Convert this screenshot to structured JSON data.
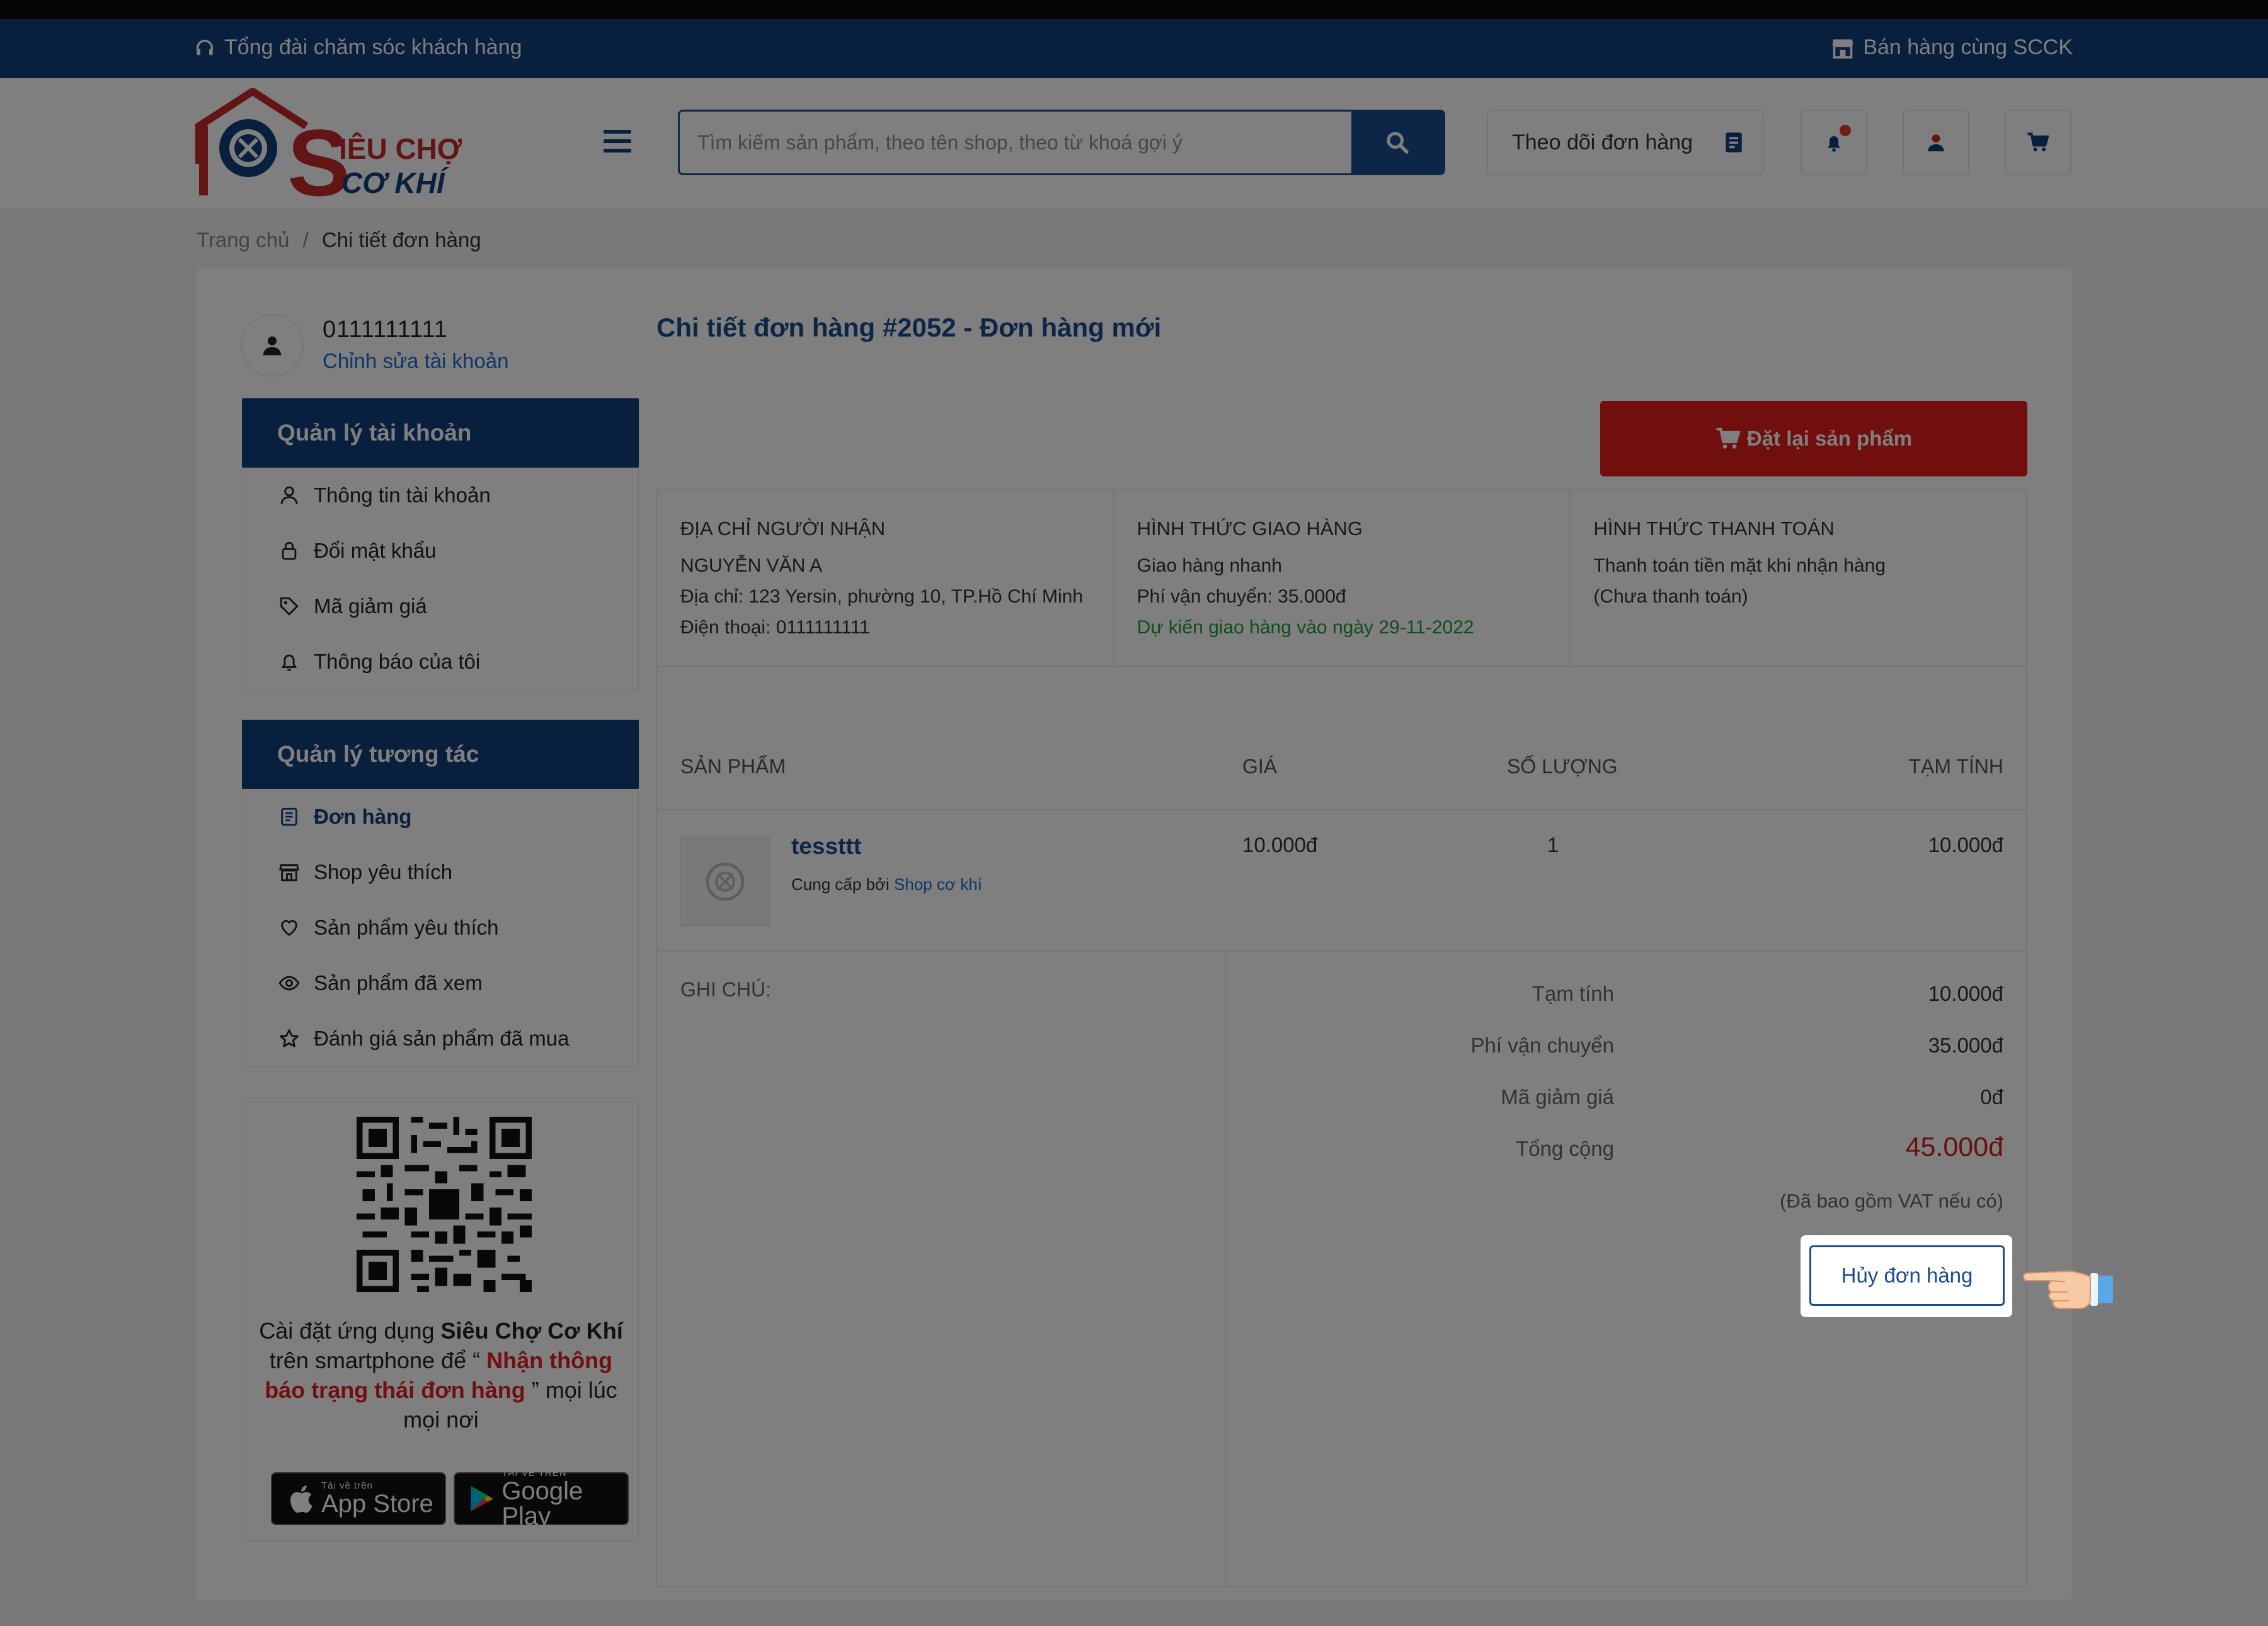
{
  "topbar": {
    "support_label": "Tổng đài chăm sóc khách hàng",
    "sell_label": "Bán hàng cùng SCCK"
  },
  "header": {
    "logo_line1": "IÊU CHỢ",
    "logo_line2": "CƠ KHÍ",
    "search_placeholder": "Tìm kiếm sản phẩm, theo tên shop, theo từ khoá gợi ý",
    "track_label": "Theo dõi đơn hàng"
  },
  "breadcrumb": {
    "home": "Trang chủ",
    "separator": "/",
    "current": "Chi tiết đơn hàng"
  },
  "account": {
    "phone": "0111111111",
    "edit_label": "Chỉnh sửa tài khoản"
  },
  "sidebar": {
    "section1": {
      "title": "Quản lý tài khoản",
      "items": [
        {
          "label": "Thông tin tài khoản",
          "icon": "user-icon"
        },
        {
          "label": "Đổi mật khẩu",
          "icon": "lock-icon"
        },
        {
          "label": "Mã giảm giá",
          "icon": "tag-icon"
        },
        {
          "label": "Thông báo của tôi",
          "icon": "bell-icon"
        }
      ]
    },
    "section2": {
      "title": "Quản lý tương tác",
      "items": [
        {
          "label": "Đơn hàng",
          "icon": "orders-icon",
          "active": true
        },
        {
          "label": "Shop yêu thích",
          "icon": "store-icon"
        },
        {
          "label": "Sản phẩm yêu thích",
          "icon": "heart-icon"
        },
        {
          "label": "Sản phẩm đã xem",
          "icon": "eye-icon"
        },
        {
          "label": "Đánh giá sản phẩm đã mua",
          "icon": "star-icon"
        }
      ]
    }
  },
  "app_promo": {
    "text1": "Cài đặt ứng dụng ",
    "app_name": "Siêu Chợ Cơ Khí",
    "text2": " trên smartphone để “ ",
    "highlight": "Nhận thông báo trạng thái đơn hàng",
    "text3": " ” mọi lúc mọi nơi",
    "appstore_small": "Tải về trên",
    "appstore_big": "App Store",
    "googleplay_small": "TẢI VỀ TRÊN",
    "googleplay_big": "Google Play"
  },
  "order": {
    "title": "Chi tiết đơn hàng #2052 - Đơn hàng mới",
    "reorder_label": "Đặt lại sản phẩm",
    "recipient": {
      "heading": "ĐỊA CHỈ NGƯỜI NHẬN",
      "name": "NGUYỄN VĂN A",
      "address": "Địa chỉ: 123 Yersin, phường 10, TP.Hồ Chí Minh",
      "phone": "Điện thoại: 0111111111"
    },
    "shipping": {
      "heading": "HÌNH THỨC GIAO HÀNG",
      "method": "Giao hàng nhanh",
      "fee": "Phí vận chuyển: 35.000đ",
      "eta": "Dự kiến giao hàng vào ngày 29-11-2022"
    },
    "payment": {
      "heading": "HÌNH THỨC THANH TOÁN",
      "method": "Thanh toán tiền mặt khi nhận hàng",
      "status": "(Chưa thanh toán)"
    },
    "table": {
      "headers": [
        "SẢN PHẨM",
        "GIÁ",
        "SỐ LƯỢNG",
        "TẠM TÍNH"
      ],
      "items": [
        {
          "name": "tessttt",
          "supplier_prefix": "Cung cấp bởi",
          "supplier": "Shop cơ khí",
          "price": "10.000đ",
          "qty": "1",
          "subtotal": "10.000đ"
        }
      ]
    },
    "note_label": "GHI CHÚ:",
    "summary": {
      "subtotal_label": "Tạm tính",
      "subtotal": "10.000đ",
      "shipping_label": "Phí vận chuyển",
      "shipping": "35.000đ",
      "discount_label": "Mã giảm giá",
      "discount": "0đ",
      "total_label": "Tổng cộng",
      "total": "45.000đ",
      "vat_note": "(Đã bao gồm VAT nếu có)"
    },
    "cancel_label": "Hủy đơn hàng"
  },
  "colors": {
    "brand": "#123f7c",
    "accent_red": "#e21f1f",
    "link": "#1a6fd1",
    "green": "#1f9d3a"
  }
}
